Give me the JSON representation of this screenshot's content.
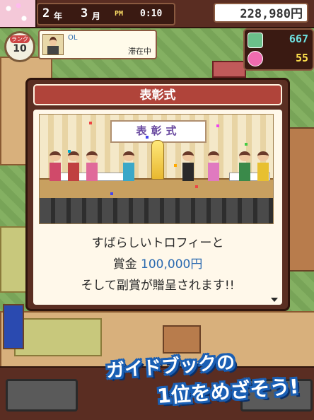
{
  "topbar": {
    "year_value": "2",
    "year_unit": "年",
    "month_value": "3",
    "month_unit": "月",
    "ampm": "PM",
    "time": "0:10",
    "money": "228,980円"
  },
  "rank": {
    "label": "ランク",
    "value": "10"
  },
  "visitor": {
    "type": "OL",
    "status": "滞在中"
  },
  "counters": {
    "book": "667",
    "coin": "55"
  },
  "dialog": {
    "title": "表彰式",
    "banner": "表彰式",
    "line1": "すばらしいトロフィーと",
    "line2_prefix": "賞金",
    "line2_amount": "100,000円",
    "line3": "そして副賞が贈呈されます!!"
  },
  "promo": {
    "line1": "ガイドブックの",
    "line2": "1位をめざそう!"
  },
  "colors": {
    "accent_blue": "#2a6ab0",
    "title_red": "#b0443a",
    "frame_brown": "#5a2e22"
  }
}
